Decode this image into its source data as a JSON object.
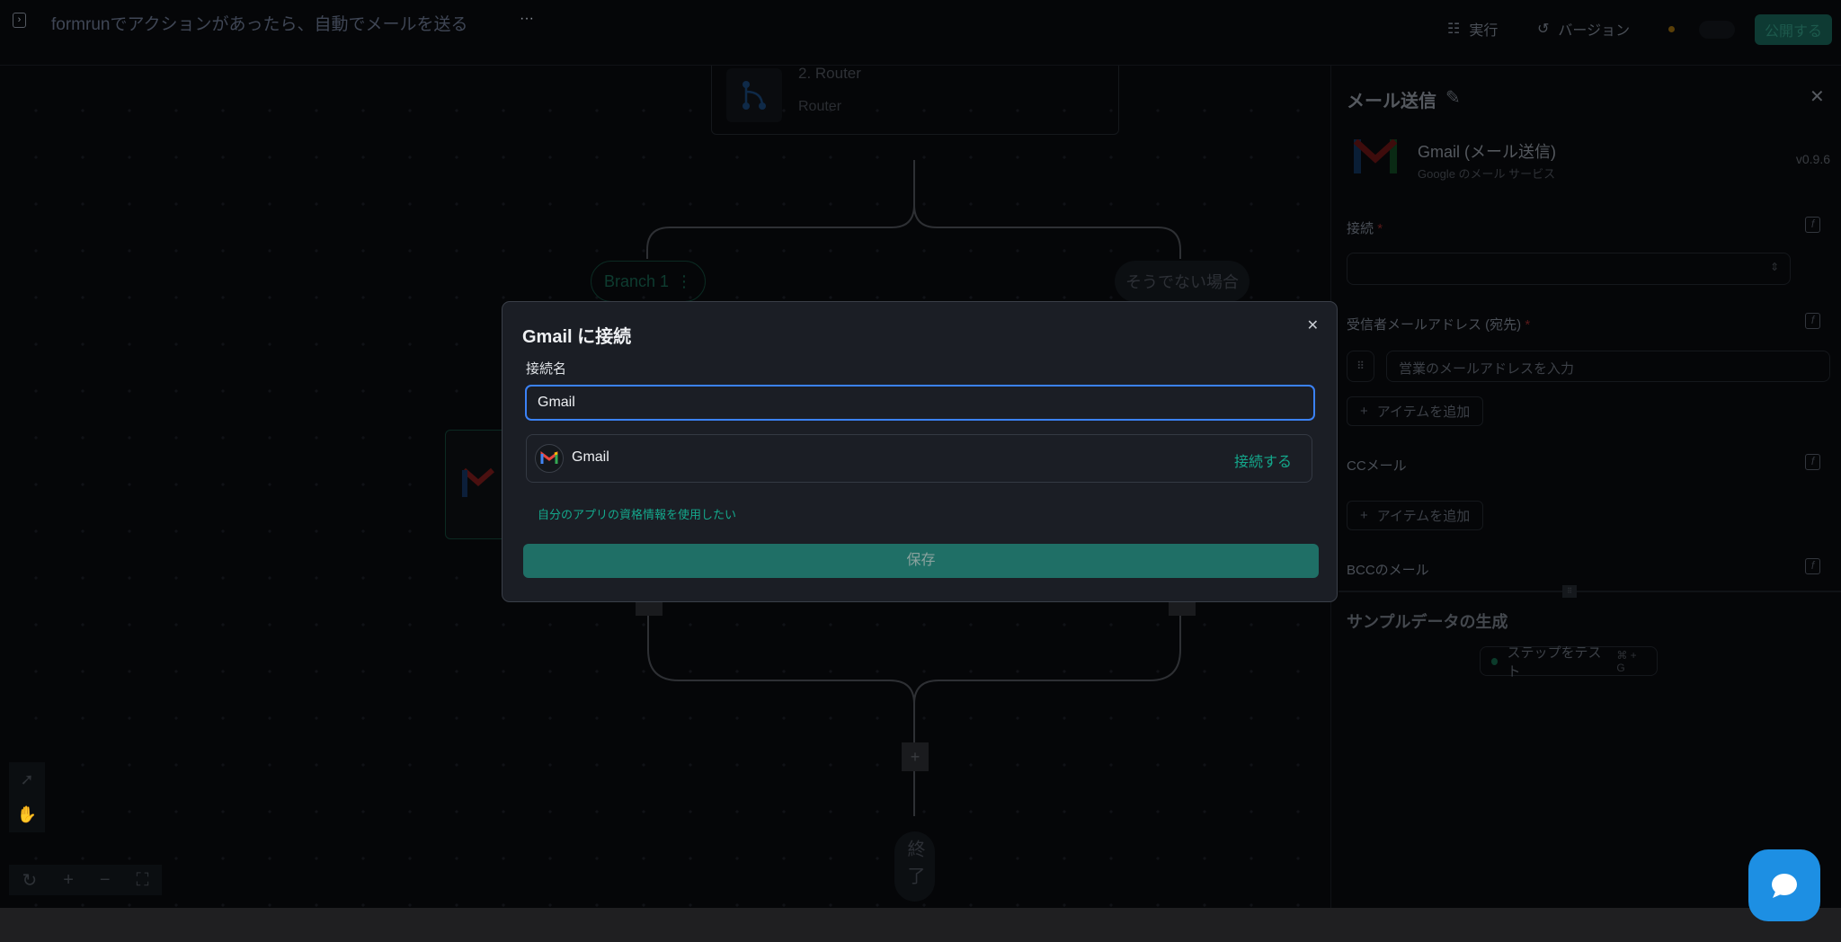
{
  "header": {
    "title": "formrunでアクションがあったら、自動でメールを送る",
    "more": "···",
    "run_label": "実行",
    "version_label": "バージョン",
    "publish_label": "公開する"
  },
  "canvas": {
    "router_title": "2. Router",
    "router_subtitle": "Router",
    "branch1": "Branch 1",
    "otherwise": "そうでない場合",
    "end_label": "終了",
    "add": "+"
  },
  "panel": {
    "title": "メール送信",
    "app_name": "Gmail (メール送信)",
    "app_desc": "Google のメール サービス",
    "version": "v0.9.6",
    "connection_label": "接続",
    "recipient_label": "受信者メールアドレス (宛先)",
    "recipient_placeholder": "営業のメールアドレスを入力",
    "add_item": "アイテムを追加",
    "cc_label": "CCメール",
    "bcc_label": "BCCのメール",
    "required_mark": "*",
    "fx": "f",
    "sample_title": "サンプルデータの生成",
    "test_step": "ステップをテスト",
    "test_shortcut": "⌘ + G"
  },
  "modal": {
    "title": "Gmail に接続",
    "name_label": "接続名",
    "name_value": "Gmail",
    "provider": "Gmail",
    "connect_label": "接続する",
    "own_app_link": "自分のアプリの資格情報を使用したい",
    "save_label": "保存"
  },
  "colors": {
    "accent": "#14a88c",
    "input_focus": "#3b82f6",
    "save_bg": "#1f6f66",
    "chat": "#1d8fe3"
  }
}
